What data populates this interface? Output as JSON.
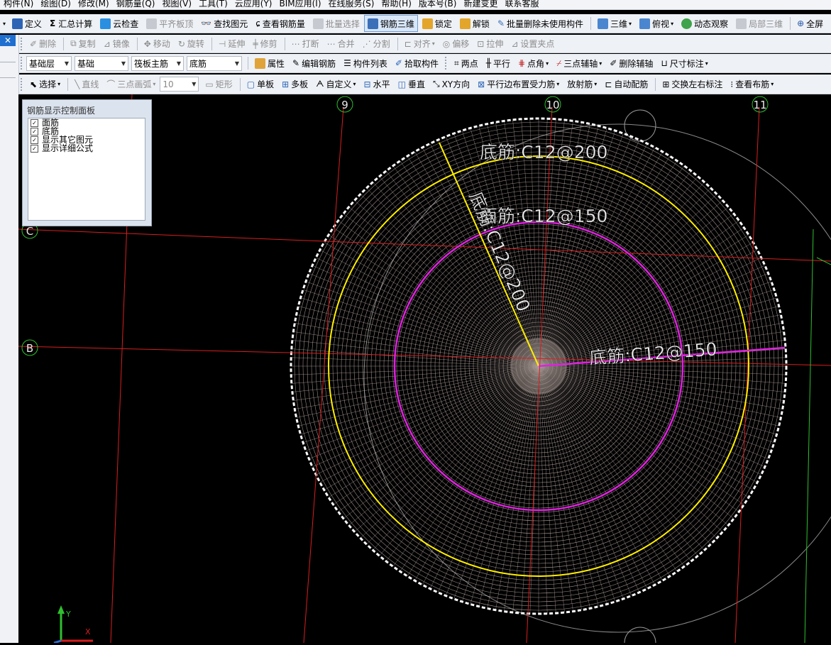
{
  "menubar": {
    "items": [
      "构件(N)",
      "绘图(D)",
      "修改(M)",
      "钢筋量(Q)",
      "视图(V)",
      "工具(T)",
      "云应用(Y)",
      "BIM应用(I)",
      "在线服务(S)",
      "帮助(H)",
      "版本号(B)",
      "新建变更",
      "联系客服"
    ]
  },
  "toolbar1": {
    "define": "定义",
    "calc": "汇总计算",
    "cloud_check": "云检查",
    "flat_top": "平齐板顶",
    "find": "查找图元",
    "view_rebar": "查看钢筋量",
    "batch_select": "批量选择",
    "rebar_3d": "钢筋三维",
    "lock": "锁定",
    "unlock": "解锁",
    "batch_delete": "批量删除未使用构件",
    "view_3d": "三维",
    "top_view": "俯视",
    "dynamic_view": "动态观察",
    "local_3d": "局部三维",
    "full_screen": "全屏"
  },
  "toolbar2": {
    "delete": "删除",
    "copy": "复制",
    "mirror": "镜像",
    "move": "移动",
    "rotate": "旋转",
    "extend": "延伸",
    "trim": "修剪",
    "break": "打断",
    "merge": "合并",
    "split": "分割",
    "align": "对齐",
    "offset": "偏移",
    "stretch": "拉伸",
    "set_point": "设置夹点"
  },
  "toolbar3": {
    "layer": "基础层",
    "category": "基础",
    "component_type": "筏板主筋",
    "component_name": "底筋",
    "properties": "属性",
    "edit_rebar": "编辑钢筋",
    "component_list": "构件列表",
    "pick_component": "拾取构件",
    "two_points": "两点",
    "parallel": "平行",
    "point_angle": "点角",
    "three_point_axis": "三点辅轴",
    "delete_axis": "删除辅轴",
    "dimension": "尺寸标注"
  },
  "toolbar4": {
    "select": "选择",
    "line": "直线",
    "arc": "三点画弧",
    "width_value": "10",
    "rect": "矩形",
    "single_slab": "单板",
    "multi_slab": "多板",
    "custom": "自定义",
    "horizontal": "水平",
    "vertical": "垂直",
    "xy_dir": "XY方向",
    "parallel_edge": "平行边布置受力筋",
    "radial": "放射筋",
    "auto_arrange": "自动配筋",
    "swap_labels": "交换左右标注",
    "view_layout": "查看布筋"
  },
  "panel": {
    "title": "钢筋显示控制面板",
    "options": [
      {
        "label": "面筋",
        "checked": true
      },
      {
        "label": "底筋",
        "checked": true
      },
      {
        "label": "显示其它图元",
        "checked": true
      },
      {
        "label": "显示详细公式",
        "checked": true
      }
    ]
  },
  "canvas": {
    "axis_numbers": [
      "9",
      "10",
      "11"
    ],
    "axis_letters": [
      "C",
      "B"
    ],
    "rebar_labels": {
      "outer_bottom": "底筋:C12@200",
      "top_mid": "面筋:C12@150",
      "radial_diag": "底筋:C12@200",
      "right": "底筋:C12@150"
    },
    "ucs_x": "X",
    "ucs_y": "Y"
  },
  "colors": {
    "background": "#000000",
    "grid_line": "#d81e1e",
    "yellow_ring": "#ffee00",
    "magenta_ring": "#e020e0",
    "rebar": "#c9b9b4",
    "axis_circle": "#2fbf2f",
    "toolbar_bg": "#eef1f6"
  }
}
